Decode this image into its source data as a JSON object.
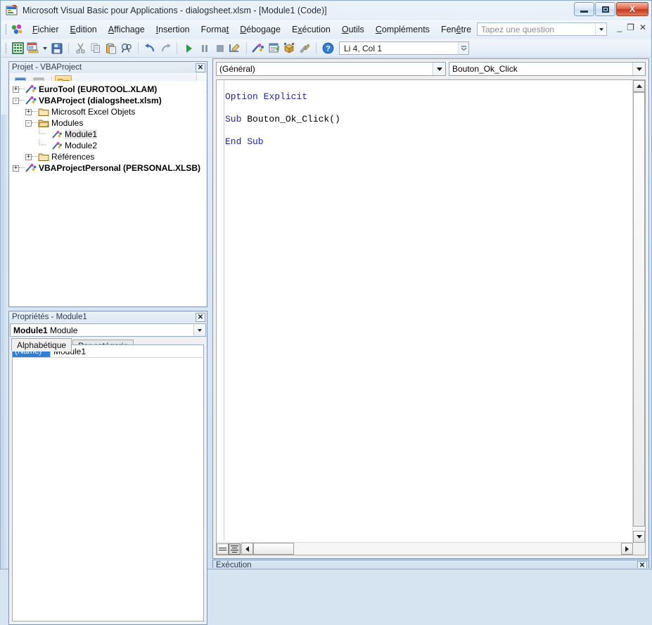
{
  "window": {
    "title": "Microsoft Visual Basic pour Applications - dialogsheet.xlsm - [Module1 (Code)]",
    "icon": "vba-app-icon",
    "buttons": {
      "minimize": "minimize-window",
      "restore": "restore-window",
      "close": "close-window",
      "close_glyph": "X"
    }
  },
  "menubar": {
    "icon": "vba-project-icon",
    "items": [
      {
        "label": "Fichier",
        "accel": "F"
      },
      {
        "label": "Edition",
        "accel": "E"
      },
      {
        "label": "Affichage",
        "accel": "A"
      },
      {
        "label": "Insertion",
        "accel": "I"
      },
      {
        "label": "Format",
        "accel": "t"
      },
      {
        "label": "Débogage",
        "accel": "D"
      },
      {
        "label": "Exécution",
        "accel": "x"
      },
      {
        "label": "Outils",
        "accel": "O"
      },
      {
        "label": "Compléments",
        "accel": "C"
      },
      {
        "label": "Fenêtre",
        "accel": "ê"
      },
      {
        "label": "?",
        "accel": ""
      }
    ],
    "ask_box": {
      "placeholder": "Tapez une question",
      "value": ""
    },
    "mdi_buttons": {
      "minimize": "_",
      "restore": "❐",
      "close": "✕"
    }
  },
  "toolbar": {
    "buttons": [
      {
        "name": "view-excel-icon",
        "tip": "Afficher Microsoft Excel"
      },
      {
        "name": "insert-userform-icon",
        "tip": "Insérer UserForm"
      },
      {
        "name": "save-icon",
        "tip": "Enregistrer dialogsheet.xlsm"
      },
      {
        "name": "cut-icon",
        "tip": "Couper"
      },
      {
        "name": "copy-icon",
        "tip": "Copier"
      },
      {
        "name": "paste-icon",
        "tip": "Coller"
      },
      {
        "name": "find-icon",
        "tip": "Rechercher"
      },
      {
        "name": "undo-icon",
        "tip": "Annuler"
      },
      {
        "name": "redo-icon",
        "tip": "Répéter"
      },
      {
        "name": "run-icon",
        "tip": "Exécuter Sub/UserForm"
      },
      {
        "name": "pause-icon",
        "tip": "Arrêt"
      },
      {
        "name": "stop-icon",
        "tip": "Réinitialiser"
      },
      {
        "name": "design-mode-icon",
        "tip": "Mode création"
      },
      {
        "name": "project-explorer-icon",
        "tip": "Explorateur de projet"
      },
      {
        "name": "properties-window-icon",
        "tip": "Fenêtre Propriétés"
      },
      {
        "name": "object-browser-icon",
        "tip": "Explorateur d'objets"
      },
      {
        "name": "toolbox-icon",
        "tip": "Boîte à outils"
      },
      {
        "name": "help-icon",
        "tip": "Aide"
      }
    ],
    "position": {
      "label": "Li 4, Col 1"
    }
  },
  "project_explorer": {
    "title": "Projet - VBAProject",
    "close_glyph": "✕",
    "toolbar": [
      {
        "name": "view-code-icon",
        "active": false
      },
      {
        "name": "view-object-icon",
        "active": false
      },
      {
        "name": "toggle-folders-icon",
        "active": true
      }
    ],
    "tree": [
      {
        "indent": 0,
        "expander": "+",
        "icon": "project-icon",
        "label": "EuroTool (EUROTOOL.XLAM)",
        "bold": true,
        "selected": false
      },
      {
        "indent": 0,
        "expander": "-",
        "icon": "project-icon",
        "label": "VBAProject (dialogsheet.xlsm)",
        "bold": true,
        "selected": false
      },
      {
        "indent": 1,
        "expander": "+",
        "icon": "folder-icon",
        "label": "Microsoft Excel Objets",
        "bold": false,
        "selected": false
      },
      {
        "indent": 1,
        "expander": "-",
        "icon": "modules-folder-icon",
        "label": "Modules",
        "bold": false,
        "selected": false
      },
      {
        "indent": 2,
        "expander": "",
        "icon": "module-icon",
        "label": "Module1",
        "bold": false,
        "selected": true
      },
      {
        "indent": 2,
        "expander": "",
        "icon": "module-icon",
        "label": "Module2",
        "bold": false,
        "selected": false
      },
      {
        "indent": 1,
        "expander": "+",
        "icon": "folder-icon",
        "label": "Références",
        "bold": false,
        "selected": false
      },
      {
        "indent": 0,
        "expander": "+",
        "icon": "project-icon",
        "label": "VBAProjectPersonal (PERSONAL.XLSB)",
        "bold": true,
        "selected": false
      }
    ]
  },
  "properties": {
    "title": "Propriétés - Module1",
    "close_glyph": "✕",
    "object_name": "Module1",
    "object_type": "Module",
    "tabs": [
      {
        "label": "Alphabétique",
        "active": true
      },
      {
        "label": "Par catégorie",
        "active": false
      }
    ],
    "rows": [
      {
        "name": "(Name)",
        "value": "Module1"
      }
    ]
  },
  "code_window": {
    "object_dropdown": {
      "value": "(Général)"
    },
    "procedure_dropdown": {
      "value": "Bouton_Ok_Click"
    },
    "lines": [
      [
        {
          "t": "Option Explicit",
          "c": "kw"
        }
      ],
      [
        {
          "t": "",
          "c": "id"
        }
      ],
      [
        {
          "t": "Sub ",
          "c": "kw"
        },
        {
          "t": "Bouton_Ok_Click()",
          "c": "id"
        }
      ],
      [
        {
          "t": "",
          "c": "id"
        }
      ],
      [
        {
          "t": "End Sub",
          "c": "kw"
        }
      ]
    ],
    "view_buttons": [
      {
        "name": "procedure-view-button",
        "pressed": false
      },
      {
        "name": "full-module-view-button",
        "pressed": true
      }
    ],
    "colors": {
      "keyword": "#1f1fa8",
      "identifier": "#000000",
      "background": "#ffffff"
    }
  },
  "immediate_window": {
    "title": "Exécution"
  }
}
